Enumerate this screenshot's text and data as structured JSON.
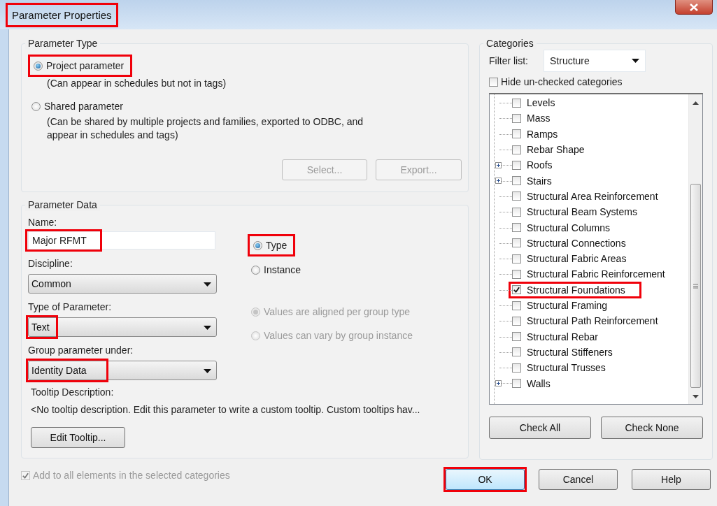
{
  "window": {
    "title": "Parameter Properties",
    "highlighted": true
  },
  "parameter_type": {
    "label": "Parameter Type",
    "options": [
      {
        "label": "Project parameter",
        "note": "(Can appear in schedules but not in tags)",
        "selected": true,
        "highlighted": true
      },
      {
        "label": "Shared parameter",
        "note": "(Can be shared by multiple projects and families, exported to ODBC, and appear in schedules and tags)",
        "selected": false,
        "highlighted": false
      }
    ],
    "buttons": [
      {
        "label": "Select...",
        "disabled": true
      },
      {
        "label": "Export...",
        "disabled": true
      }
    ]
  },
  "parameter_data": {
    "label": "Parameter Data",
    "name": {
      "label": "Name:",
      "value": "Major RFMT",
      "highlighted": true
    },
    "fields": [
      {
        "label": "Discipline:",
        "value": "Common",
        "highlighted": false
      },
      {
        "label": "Type of Parameter:",
        "value": "Text",
        "highlighted": true
      },
      {
        "label": "Group parameter under:",
        "value": "Identity Data",
        "highlighted": true
      }
    ],
    "scope": [
      {
        "label": "Type",
        "selected": true,
        "disabled": false,
        "highlighted": true
      },
      {
        "label": "Instance",
        "selected": false,
        "disabled": false,
        "highlighted": false
      }
    ],
    "group_values": [
      {
        "label": "Values are aligned per group type",
        "selected": true,
        "disabled": true,
        "highlighted": false
      },
      {
        "label": "Values can vary by group instance",
        "selected": false,
        "disabled": true,
        "highlighted": false
      }
    ],
    "tooltip": {
      "label": "Tooltip Description:",
      "text": "<No tooltip description. Edit this parameter to write a custom tooltip. Custom tooltips hav..."
    },
    "edit_button": "Edit Tooltip..."
  },
  "categories": {
    "label": "Categories",
    "filter_label": "Filter list:",
    "filter_value": "Structure",
    "hide_unchecked": {
      "label": "Hide un-checked categories",
      "checked": false
    },
    "items": [
      {
        "label": "Levels",
        "checked": false,
        "expandable": false,
        "highlighted": false
      },
      {
        "label": "Mass",
        "checked": false,
        "expandable": false,
        "highlighted": false
      },
      {
        "label": "Ramps",
        "checked": false,
        "expandable": false,
        "highlighted": false
      },
      {
        "label": "Rebar Shape",
        "checked": false,
        "expandable": false,
        "highlighted": false
      },
      {
        "label": "Roofs",
        "checked": false,
        "expandable": true,
        "highlighted": false
      },
      {
        "label": "Stairs",
        "checked": false,
        "expandable": true,
        "highlighted": false
      },
      {
        "label": "Structural Area Reinforcement",
        "checked": false,
        "expandable": false,
        "highlighted": false
      },
      {
        "label": "Structural Beam Systems",
        "checked": false,
        "expandable": false,
        "highlighted": false
      },
      {
        "label": "Structural Columns",
        "checked": false,
        "expandable": false,
        "highlighted": false
      },
      {
        "label": "Structural Connections",
        "checked": false,
        "expandable": false,
        "highlighted": false
      },
      {
        "label": "Structural Fabric Areas",
        "checked": false,
        "expandable": false,
        "highlighted": false
      },
      {
        "label": "Structural Fabric Reinforcement",
        "checked": false,
        "expandable": false,
        "highlighted": false
      },
      {
        "label": "Structural Foundations",
        "checked": true,
        "expandable": false,
        "highlighted": true
      },
      {
        "label": "Structural Framing",
        "checked": false,
        "expandable": false,
        "highlighted": false
      },
      {
        "label": "Structural Path Reinforcement",
        "checked": false,
        "expandable": false,
        "highlighted": false
      },
      {
        "label": "Structural Rebar",
        "checked": false,
        "expandable": false,
        "highlighted": false
      },
      {
        "label": "Structural Stiffeners",
        "checked": false,
        "expandable": false,
        "highlighted": false
      },
      {
        "label": "Structural Trusses",
        "checked": false,
        "expandable": false,
        "highlighted": false
      },
      {
        "label": "Walls",
        "checked": false,
        "expandable": true,
        "highlighted": false
      }
    ],
    "buttons": [
      {
        "label": "Check All"
      },
      {
        "label": "Check None"
      }
    ]
  },
  "footer": {
    "add_all": {
      "label": "Add to all elements in the selected categories",
      "checked": true,
      "disabled": true
    },
    "buttons": [
      {
        "label": "OK",
        "default": true,
        "highlighted": true
      },
      {
        "label": "Cancel",
        "default": false,
        "highlighted": false
      },
      {
        "label": "Help",
        "default": false,
        "highlighted": false
      }
    ]
  }
}
